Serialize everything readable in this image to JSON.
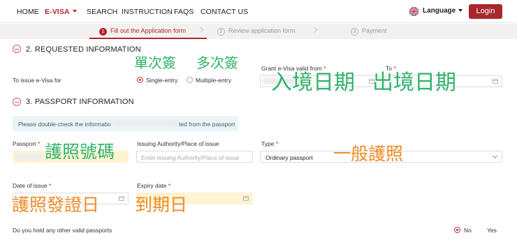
{
  "nav": {
    "home": "HOME",
    "evisa": "E-VISA",
    "search": "SEARCH",
    "instruction": "INSTRUCTION",
    "faqs": "FAQS",
    "contact": "CONTACT US",
    "language": "Language",
    "login": "Login"
  },
  "steps": [
    {
      "num": "1",
      "label": "Fill out the Application form"
    },
    {
      "num": "2",
      "label": "Review application form"
    },
    {
      "num": "3",
      "label": "Payment"
    }
  ],
  "section2": {
    "title": "2. REQUESTED INFORMATION",
    "issue_label": "To issue e-Visa for",
    "option_single": "Single-entry",
    "option_multiple": "Multiple-entry",
    "valid_from_label": "Grant e-Visa valid from",
    "to_label": "To",
    "required_mark": "*"
  },
  "section3": {
    "title": "3. PASSPORT INFORMATION",
    "notice_start": "Please double-check the informatio",
    "notice_end": "ted from the passport",
    "passport_label": "Passport",
    "authority_label": "Issuing Authority/Place of issue",
    "authority_placeholder": "Enter Issuing Authority/Place of issue",
    "type_label": "Type",
    "type_value": "Ordinary passport",
    "date_issue_label": "Date of issue",
    "expiry_label": "Expiry date",
    "other_passport_question": "Do you hold any other valid passports",
    "option_no": "No",
    "option_yes": "Yes",
    "required_mark": "*"
  },
  "annotations": {
    "single_entry": "單次簽",
    "multi_entry": "多次簽",
    "entry_date": "入境日期",
    "exit_date": "出境日期",
    "passport_number": "護照號碼",
    "ordinary_passport": "一般護照",
    "issue_date": "護照發證日",
    "expiry": "到期日"
  },
  "colors": {
    "brand": "#b2262e",
    "annotation_green": "#2fb36a",
    "annotation_orange": "#ee8a24"
  }
}
